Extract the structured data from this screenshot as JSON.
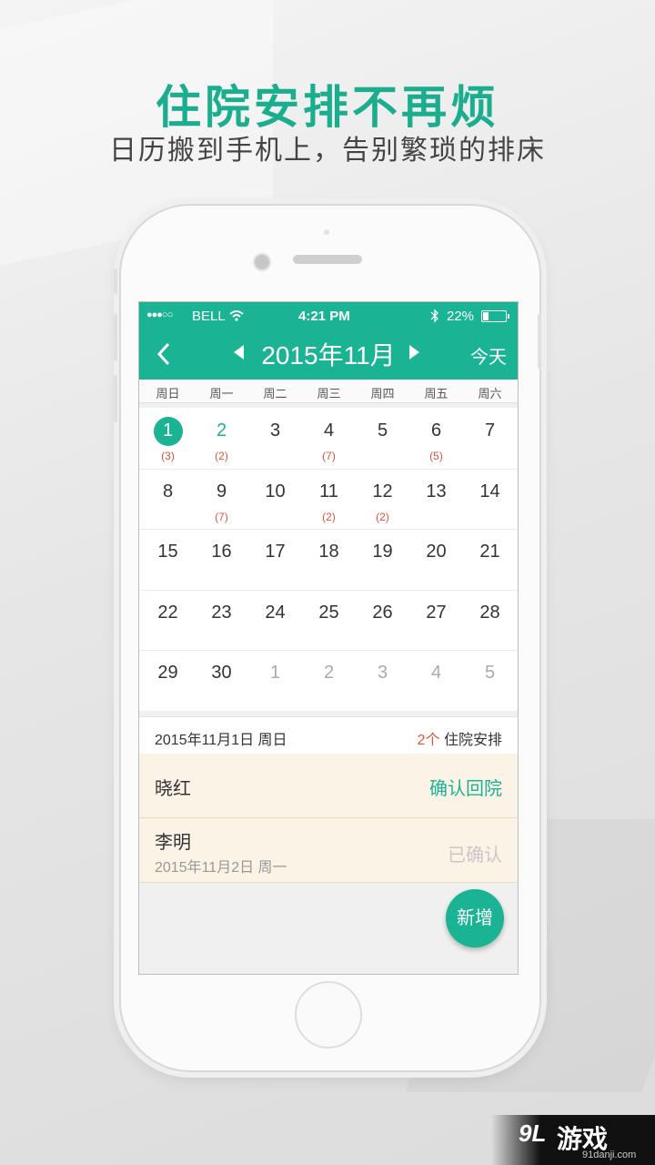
{
  "promo": {
    "headline": "住院安排不再烦",
    "subline": "日历搬到手机上，告别繁琐的排床"
  },
  "statusbar": {
    "signal": "●●●○○",
    "carrier": "BELL",
    "time": "4:21 PM",
    "battery": "22%"
  },
  "nav": {
    "back_icon": "‹",
    "month": "2015年11月",
    "today_label": "今天"
  },
  "weekdays": [
    "周日",
    "周一",
    "周二",
    "周三",
    "周四",
    "周五",
    "周六"
  ],
  "calendar": {
    "weeks": [
      [
        {
          "d": "1",
          "c": "(3)",
          "s": "today"
        },
        {
          "d": "2",
          "c": "(2)",
          "s": "sel"
        },
        {
          "d": "3",
          "c": ""
        },
        {
          "d": "4",
          "c": "(7)"
        },
        {
          "d": "5",
          "c": ""
        },
        {
          "d": "6",
          "c": "(5)"
        },
        {
          "d": "7",
          "c": ""
        }
      ],
      [
        {
          "d": "8",
          "c": ""
        },
        {
          "d": "9",
          "c": "(7)"
        },
        {
          "d": "10",
          "c": ""
        },
        {
          "d": "11",
          "c": "(2)"
        },
        {
          "d": "12",
          "c": "(2)"
        },
        {
          "d": "13",
          "c": ""
        },
        {
          "d": "14",
          "c": ""
        }
      ],
      [
        {
          "d": "15",
          "c": ""
        },
        {
          "d": "16",
          "c": ""
        },
        {
          "d": "17",
          "c": ""
        },
        {
          "d": "18",
          "c": ""
        },
        {
          "d": "19",
          "c": ""
        },
        {
          "d": "20",
          "c": ""
        },
        {
          "d": "21",
          "c": ""
        }
      ],
      [
        {
          "d": "22",
          "c": ""
        },
        {
          "d": "23",
          "c": ""
        },
        {
          "d": "24",
          "c": ""
        },
        {
          "d": "25",
          "c": ""
        },
        {
          "d": "26",
          "c": ""
        },
        {
          "d": "27",
          "c": ""
        },
        {
          "d": "28",
          "c": ""
        }
      ],
      [
        {
          "d": "29",
          "c": ""
        },
        {
          "d": "30",
          "c": ""
        },
        {
          "d": "1",
          "c": "",
          "s": "other"
        },
        {
          "d": "2",
          "c": "",
          "s": "other"
        },
        {
          "d": "3",
          "c": "",
          "s": "other"
        },
        {
          "d": "4",
          "c": "",
          "s": "other"
        },
        {
          "d": "5",
          "c": "",
          "s": "other"
        }
      ]
    ]
  },
  "selected_day": {
    "date": "2015年11月1日  周日",
    "count": "2个",
    "count_suffix": " 住院安排"
  },
  "items": [
    {
      "name": "晓红",
      "sub": "",
      "action": "确认回院",
      "action_color": "#1ab394"
    },
    {
      "name": "李明",
      "sub": "2015年11月2日  周一",
      "action": "已确认",
      "action_color": "#c8c8c8"
    }
  ],
  "fab_label": "新增",
  "watermark": {
    "brand": "游戏",
    "logo": "9L",
    "url": "91danji.com"
  },
  "colors": {
    "accent": "#1ab394",
    "count_red": "#e0533d",
    "item_bg": "#fbf3e6"
  }
}
